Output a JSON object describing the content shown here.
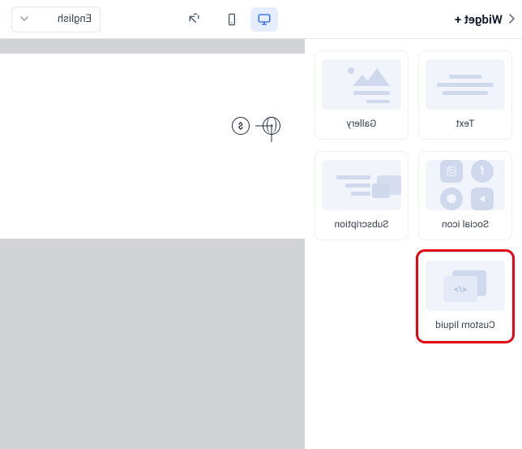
{
  "topbar": {
    "title": "Widget +",
    "language": "English"
  },
  "widgets": [
    {
      "id": "text",
      "label": "Text"
    },
    {
      "id": "gallery",
      "label": "Gallery"
    },
    {
      "id": "social",
      "label": "Social icon"
    },
    {
      "id": "subscription",
      "label": "Subscription"
    },
    {
      "id": "custom-liquid",
      "label": "Custom liquid"
    }
  ],
  "canvas": {
    "currency_symbol": "$"
  }
}
